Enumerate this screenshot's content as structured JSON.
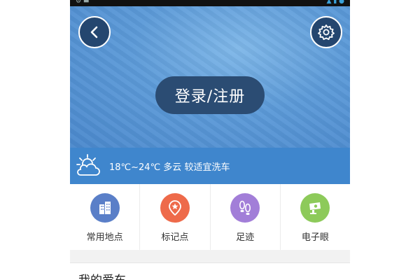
{
  "hero": {
    "login_label": "登录/注册"
  },
  "weather": {
    "text": "18℃~24℃ 多云 较适宜洗车"
  },
  "nav": {
    "items": [
      {
        "label": "常用地点",
        "icon": "building-icon",
        "color": "#5a7fc8"
      },
      {
        "label": "标记点",
        "icon": "star-pin-icon",
        "color": "#ee6a4a"
      },
      {
        "label": "足迹",
        "icon": "footprints-icon",
        "color": "#a27ed8"
      },
      {
        "label": "电子眼",
        "icon": "camera-icon",
        "color": "#8dca5a"
      }
    ]
  },
  "section": {
    "title": "我的爱车"
  },
  "colors": {
    "hero": "#5c9ad8",
    "weather_bar": "#3f86cd",
    "button": "#2b4c73"
  }
}
